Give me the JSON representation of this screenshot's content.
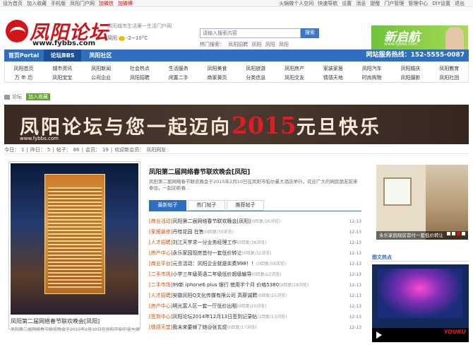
{
  "topbar": {
    "left_items": [
      "设为首页",
      "加入收藏",
      "手机版",
      "凤阳门户网",
      "加微信",
      "加微博"
    ],
    "right_items": [
      "火锅做个人空间",
      "快速导航",
      "设置",
      "消息",
      "提醒",
      "门户管理",
      "管理中心",
      "DIY设置",
      "退出"
    ]
  },
  "logo": {
    "title": "凤阳论坛",
    "url": "www.fybbs.com"
  },
  "weather": {
    "line1": "凤阳城市生活第一生活门户网",
    "line2": "凤阳",
    "temp": "-2~10°C"
  },
  "search": {
    "placeholder": "请输入搜索内容",
    "button": "搜索",
    "hot_label": "热门搜索：",
    "hot": [
      "凤阳招聘",
      "凤阳",
      "凤阳",
      "凤阳"
    ]
  },
  "banner_ad": {
    "title": "新启航",
    "sub": "www.fybbs.com"
  },
  "nav": {
    "items": [
      "首页Portal",
      "论坛BBS",
      "凤阳社区"
    ],
    "active": 1,
    "tel": "网站服务热线：152-5555-0087"
  },
  "subnav": {
    "row1": [
      "凤阳首页",
      "城市资讯",
      "凤阳新闻",
      "社会热点",
      "生活服务",
      "凤阳美食",
      "凤阳旅游",
      "凤阳房产",
      "家装家居",
      "凤阳汽车",
      "凤阳婚庆",
      "凤阳教育"
    ],
    "row2": [
      "万 年 历",
      "凤阳宝宝",
      "公司企业",
      "凤阳招聘",
      "闲置二手",
      "商家黄页",
      "分类信息",
      "凤阳交友",
      "情感天地",
      "时尚购物",
      "凤阳摄影",
      "凤阳社团"
    ]
  },
  "breadcrumb": {
    "label": "论坛",
    "fav": "加入收藏"
  },
  "main_banner": {
    "text": "凤阳论坛与您一起迈向",
    "year": "2015",
    "suffix": "元旦快乐",
    "url": "www.fybbs.com"
  },
  "stats": {
    "items": [
      "今日：",
      "1",
      "|",
      "昨日：",
      "5",
      "|",
      "帖子：",
      "86",
      "|",
      "会员：",
      "19",
      "|",
      "欢迎新会员：",
      "凤阳网友"
    ]
  },
  "photo": {
    "caption": "凤阳第二届网络春节联欢晚会[凤阳]",
    "desc": "凤阳第二届网络春节联欢晚会于2015年2月10日在凤阳市铂尔曼大酒店..."
  },
  "headline": "凤阳第二届网络春节联欢晚会[凤阳]",
  "summary": "凤阳第二届网络春节联欢晚会于2015年2月10日在凤阳市铂尔曼大酒店举行，欢迎广大的网民朋友前来参加，一起迎新春…",
  "tabs": [
    "最新帖子",
    "热门帖子",
    "推荐帖子"
  ],
  "posts": [
    {
      "cat": "[商业活动]",
      "title": "凤阳第二届网络春节联欢晚会[凤阳]",
      "meta": "(0回复/26浏览)",
      "date": "12-13"
    },
    {
      "cat": "[家居装修]",
      "title": "丹桂花园 在售",
      "meta": "(0回复/30浏览)",
      "date": "12-13"
    },
    {
      "cat": "[人才招聘]",
      "title": "刘江天学求一分业务经理工作",
      "meta": "(0回复/36浏览)",
      "date": "12-13"
    },
    {
      "cat": "[房产中心]",
      "title": "永乐家园现房首付一套低价转让",
      "meta": "(0回复/32浏览)",
      "date": "12-13"
    },
    {
      "cat": "[商业平台]",
      "title": "元旦活动：凤阳企业就是实费998！！",
      "meta": "(0回复/34浏览)",
      "date": "12-13"
    },
    {
      "cat": "[二手市场]",
      "title": "小学三年级英语二年级低价超级输导",
      "meta": "(0回复/22浏览)",
      "date": "12-13"
    },
    {
      "cat": "[二手市场]",
      "title": "99新 iphone6 plus 银行 使用半个月 价格5380",
      "meta": "(0回复/28浏览)",
      "date": "12-13"
    },
    {
      "cat": "[人才招聘]",
      "title": "安徽凤阳Q文化传媒有限公司 高薪诚聘",
      "meta": "(0回复/25浏览)",
      "date": "12-13"
    },
    {
      "cat": "[房产中心]",
      "title": "明光富人区一套一厅低价出租",
      "meta": "(0回复/20浏览)",
      "date": "12-13"
    },
    {
      "cat": "[签到中心]",
      "title": "凤阳论坛2014年12月13日签到记录帖",
      "meta": "(1回复/13浏览)",
      "date": "12-13"
    },
    {
      "cat": "[情感天堂]",
      "title": "我未来要嫁了她@张玄焜",
      "meta": "(0回复/17浏览)",
      "date": "12-13"
    }
  ],
  "right_photo": {
    "caption": "永乐家园现房首付一套低价转让",
    "dots": 4,
    "active_dot": 2
  },
  "right_section": {
    "title": "图文热点",
    "video_logo": "YOUKU"
  }
}
